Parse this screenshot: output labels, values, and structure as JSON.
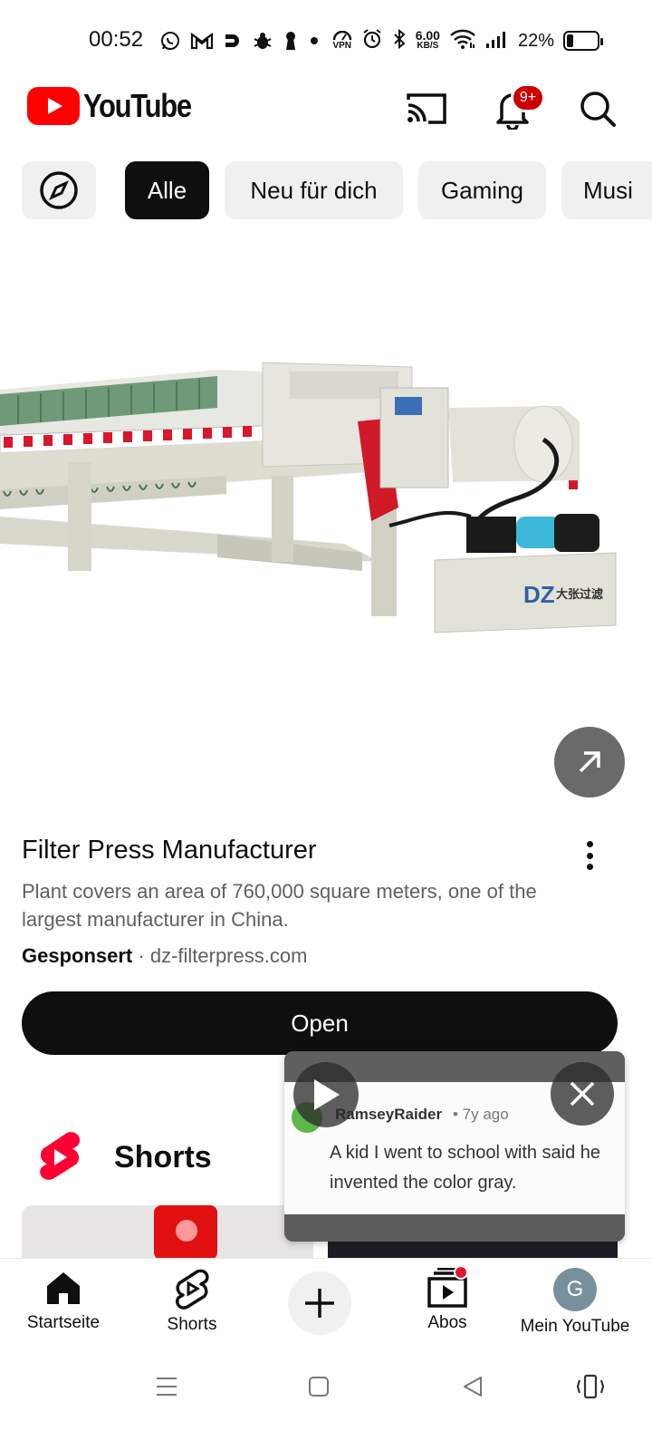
{
  "status_bar": {
    "time": "00:52",
    "network_speed": "6.00",
    "network_speed_unit": "KB/S",
    "battery_percent": "22%",
    "battery_level": 0.22,
    "vpn_label": "VPN"
  },
  "header": {
    "logo_text": "YouTube",
    "notification_badge": "9+"
  },
  "chips": {
    "items": [
      {
        "label": "Alle",
        "active": true
      },
      {
        "label": "Neu für dich"
      },
      {
        "label": "Gaming"
      },
      {
        "label": "Musi"
      }
    ]
  },
  "ad": {
    "image_text": "大张过滤",
    "title": "Filter Press Manufacturer",
    "description": "Plant covers an area of 760,000 square meters, one of the largest manufacturer in China.",
    "sponsored_label": "Gesponsert",
    "separator": " · ",
    "domain": "dz-filterpress.com",
    "cta_label": "Open"
  },
  "shorts": {
    "title": "Shorts"
  },
  "miniplayer": {
    "username": "RamseyRaider",
    "age": "• 7y ago",
    "comment": "A kid I went to school with said he invented the color gray."
  },
  "bottom_nav": {
    "items": [
      {
        "label": "Startseite"
      },
      {
        "label": "Shorts"
      },
      {
        "label": "Abos"
      },
      {
        "label": "Mein YouTube"
      }
    ],
    "avatar_letter": "G"
  },
  "colors": {
    "brand_red": "#ff0000",
    "chip_active": "#0f0f0f",
    "chip_bg": "#f0f0f0",
    "avatar": "#78909c"
  }
}
